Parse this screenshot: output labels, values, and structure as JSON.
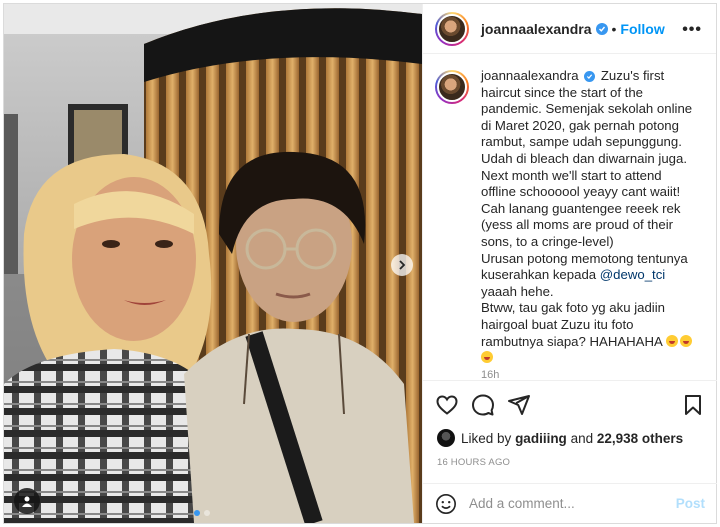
{
  "post": {
    "username": "joannaalexandra",
    "verified": true,
    "follow_label": "Follow",
    "more_label": "•••",
    "separator": "•"
  },
  "caption": {
    "username": "joannaalexandra",
    "lines": [
      "Zuzu's first",
      "haircut since the start of the",
      "pandemic. Semenjak sekolah online",
      "di Maret 2020, gak pernah potong",
      "rambut, sampe udah sepunggung.",
      "Udah di bleach dan diwarnain juga.",
      "Next month we'll start to attend",
      "offline schoooool yeayy cant waiit!",
      "Cah lanang guantengee reeek rek",
      "(yess all moms are proud of their",
      "sons, to a cringe-level)",
      "Urusan potong memotong tentunya",
      "kuserahkan kepada"
    ],
    "mention": "@dewo_tci",
    "after_mention": [
      "yaaah hehe.",
      "Btww, tau gak foto yg aku jadiin",
      "hairgoal buat Zuzu itu foto",
      "rambutnya siapa? HAHAHAHA"
    ],
    "time": "16h"
  },
  "likes": {
    "prefix": "Liked by",
    "user": "gadiiing",
    "middle": "and",
    "count": "22,938 others"
  },
  "timestamp": "16 HOURS AGO",
  "comment": {
    "placeholder": "Add a comment...",
    "post_label": "Post"
  },
  "icons": {
    "like": "heart-icon",
    "comment": "comment-icon",
    "share": "share-icon",
    "save": "bookmark-icon",
    "emoji": "smile-icon",
    "next": "chevron-right-icon",
    "tag": "user-tag-icon"
  },
  "colors": {
    "accent": "#0095f6",
    "verified": "#3897f0",
    "post_disabled": "#b2dffc",
    "muted": "#8e8e8e"
  }
}
